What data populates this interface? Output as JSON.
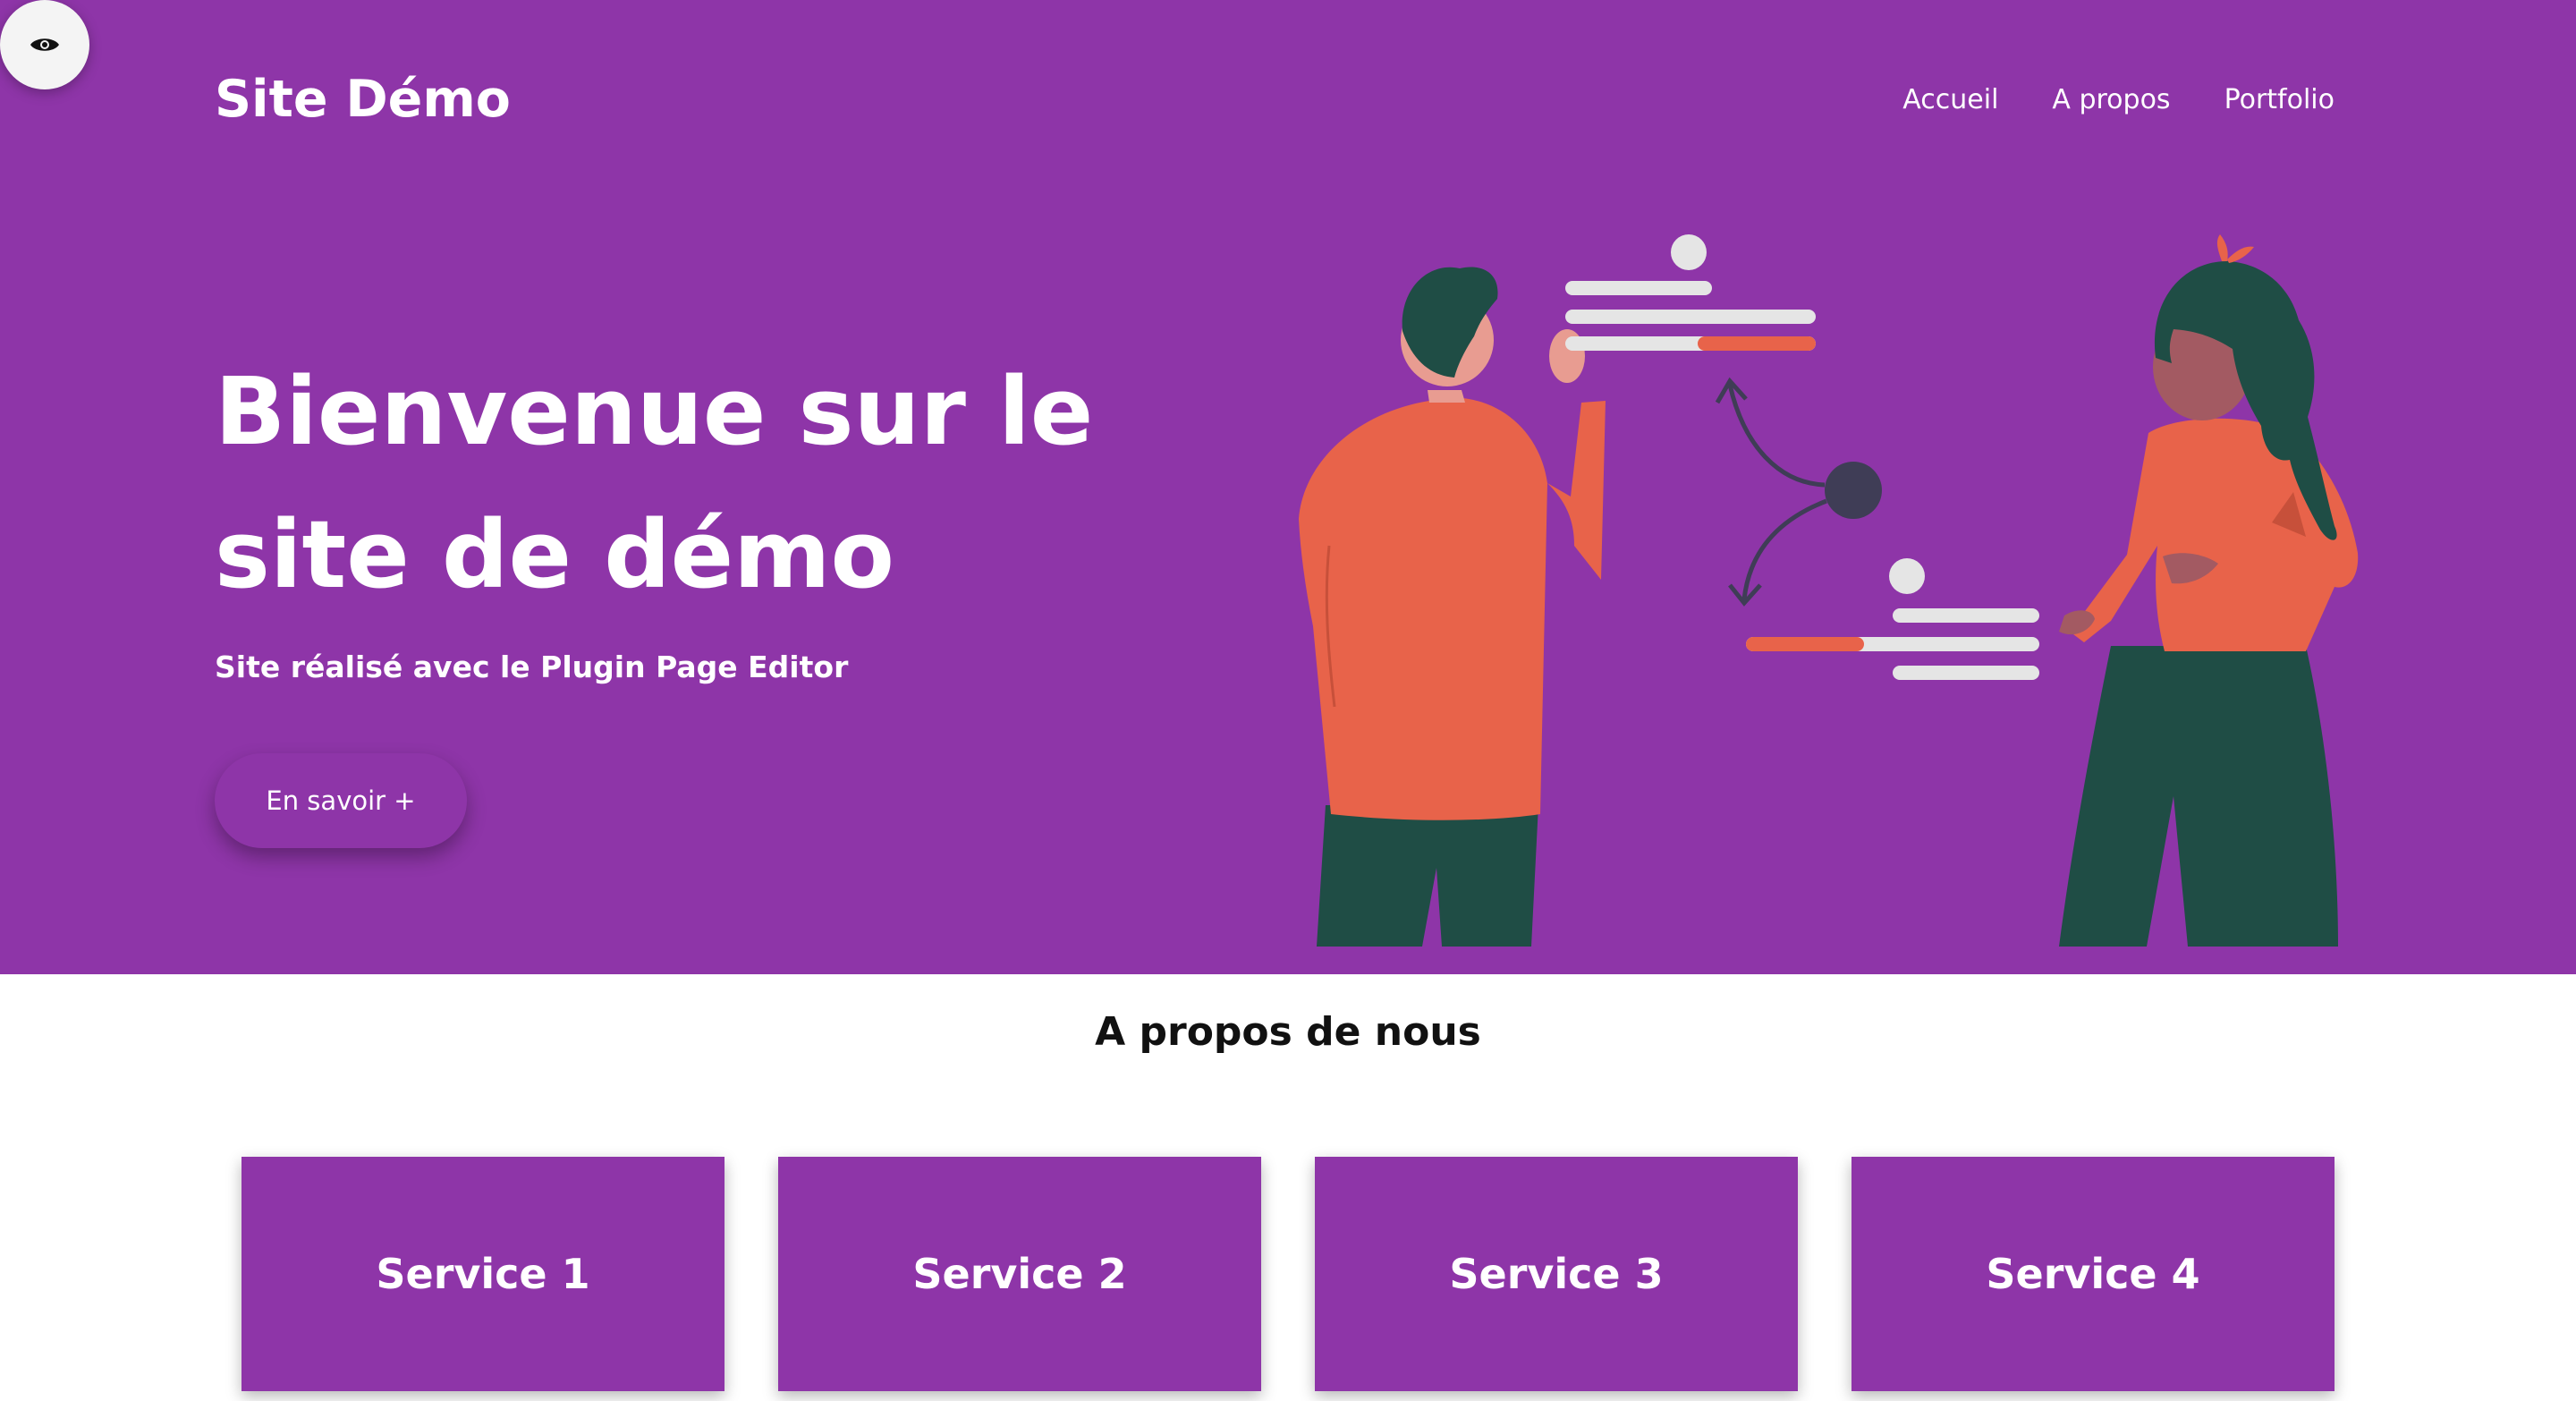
{
  "header": {
    "logo": "Site Démo",
    "nav": [
      "Accueil",
      "A propos",
      "Portfolio"
    ]
  },
  "hero": {
    "title": "Bienvenue sur le site de démo",
    "subtitle": "Site réalisé avec le Plugin Page Editor",
    "cta_label": "En savoir +"
  },
  "about": {
    "title": "A propos de nous"
  },
  "services": [
    "Service 1",
    "Service 2",
    "Service 3",
    "Service 4"
  ],
  "icons": {
    "preview_toggle": "eye-icon"
  },
  "colors": {
    "brand": "#8e35a8",
    "accent": "#e8634a",
    "dark_green": "#1f4d45"
  }
}
